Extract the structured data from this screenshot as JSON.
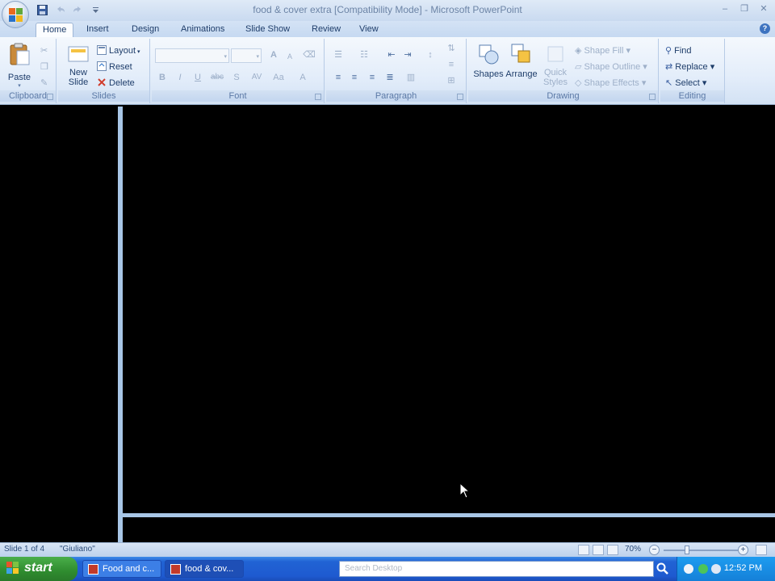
{
  "window": {
    "title": "food & cover extra [Compatibility Mode] - Microsoft PowerPoint",
    "minimize_glyph": "–",
    "maximize_glyph": "❐",
    "close_glyph": "✕"
  },
  "tabs": [
    {
      "label": "Home",
      "active": true
    },
    {
      "label": "Insert"
    },
    {
      "label": "Design"
    },
    {
      "label": "Animations"
    },
    {
      "label": "Slide Show"
    },
    {
      "label": "Review"
    },
    {
      "label": "View"
    }
  ],
  "ribbon": {
    "clipboard": {
      "label": "Clipboard",
      "paste": "Paste"
    },
    "slides": {
      "label": "Slides",
      "new_slide_1": "New",
      "new_slide_2": "Slide",
      "layout": "Layout",
      "reset": "Reset",
      "delete": "Delete"
    },
    "font": {
      "label": "Font",
      "bold": "B",
      "italic": "I",
      "underline": "U",
      "strike": "abc",
      "shadow": "S",
      "spacing": "AV",
      "case": "Aa",
      "color": "A",
      "grow": "A",
      "shrink": "A"
    },
    "paragraph": {
      "label": "Paragraph"
    },
    "drawing": {
      "label": "Drawing",
      "shapes": "Shapes",
      "arrange": "Arrange",
      "quick_1": "Quick",
      "quick_2": "Styles",
      "shape_fill": "Shape Fill",
      "shape_outline": "Shape Outline",
      "shape_effects": "Shape Effects"
    },
    "editing": {
      "label": "Editing",
      "find": "Find",
      "replace": "Replace",
      "select": "Select"
    }
  },
  "statusbar": {
    "slide_info": "Slide 1 of 4",
    "theme": "\"Giuliano\"",
    "zoom": "70%",
    "zoom_minus": "−",
    "zoom_plus": "+"
  },
  "taskbar": {
    "start": "start",
    "tasks": [
      {
        "label": "Food and c...",
        "active": false
      },
      {
        "label": "food & cov...",
        "active": true
      }
    ],
    "search_placeholder": "Search Desktop",
    "clock": "12:52 PM"
  },
  "colors": {
    "ribbon_text": "#1e3d6a",
    "taskbar_blue": "#2163d4",
    "start_green": "#3a9a3a",
    "slide_bg": "#000000",
    "pane_border": "#a8c6e6"
  }
}
